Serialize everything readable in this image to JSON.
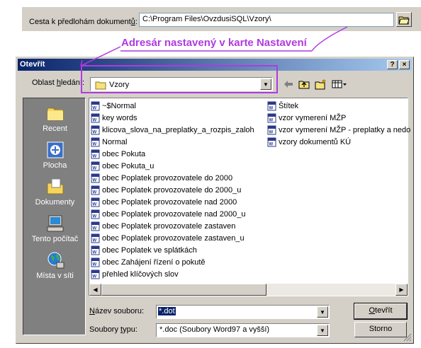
{
  "settings": {
    "label_prefix": "Cesta k předlohám dokument",
    "label_accel": "ů",
    "label_suffix": ":",
    "path_value": "C:\\Program Files\\OvzdusiSQL\\Vzory\\"
  },
  "annotation": {
    "text": "Adresár nastavený v karte Nastavení",
    "color": "#b03adf"
  },
  "dialog": {
    "title": "Otevřít",
    "help_label": "?",
    "close_label": "×",
    "lookin_prefix": "Oblast ",
    "lookin_accel": "h",
    "lookin_suffix": "ledání:",
    "lookin_value": "Vzory",
    "places": [
      {
        "label": "Recent",
        "icon": "recent-folder-icon"
      },
      {
        "label": "Plocha",
        "icon": "desktop-icon"
      },
      {
        "label": "Dokumenty",
        "icon": "my-documents-icon"
      },
      {
        "label": "Tento počítač",
        "icon": "my-computer-icon"
      },
      {
        "label": "Místa v síti",
        "icon": "network-places-icon"
      }
    ],
    "files_col1": [
      "~$Normal",
      "key words",
      "klicova_slova_na_preplatky_a_rozpis_zaloh",
      "Normal",
      "obec Pokuta",
      "obec Pokuta_u",
      "obec Poplatek provozovatele do 2000",
      "obec Poplatek provozovatele do 2000_u",
      "obec Poplatek provozovatele nad 2000",
      "obec Poplatek provozovatele nad 2000_u",
      "obec Poplatek provozovatele zastaven",
      "obec Poplatek provozovatele zastaven_u",
      "obec Poplatek ve splátkách",
      "obec Zahájení řízení o pokutě",
      "přehled klíčových slov"
    ],
    "files_col2": [
      "Štítek",
      "vzor vymerení MŽP",
      "vzor vymerení MŽP - preplatky a nedo",
      "vzory dokumentů KÚ"
    ],
    "filename_label_accel": "N",
    "filename_label_rest": "ázev souboru:",
    "filename_value": "*.dot",
    "filetype_label_prefix": "Soubory ",
    "filetype_label_accel": "t",
    "filetype_label_rest": "ypu:",
    "filetype_value": "*.doc (Soubory Word97 a vyšší)",
    "open_accel": "O",
    "open_rest": "tevřít",
    "cancel_label": "Storno"
  }
}
